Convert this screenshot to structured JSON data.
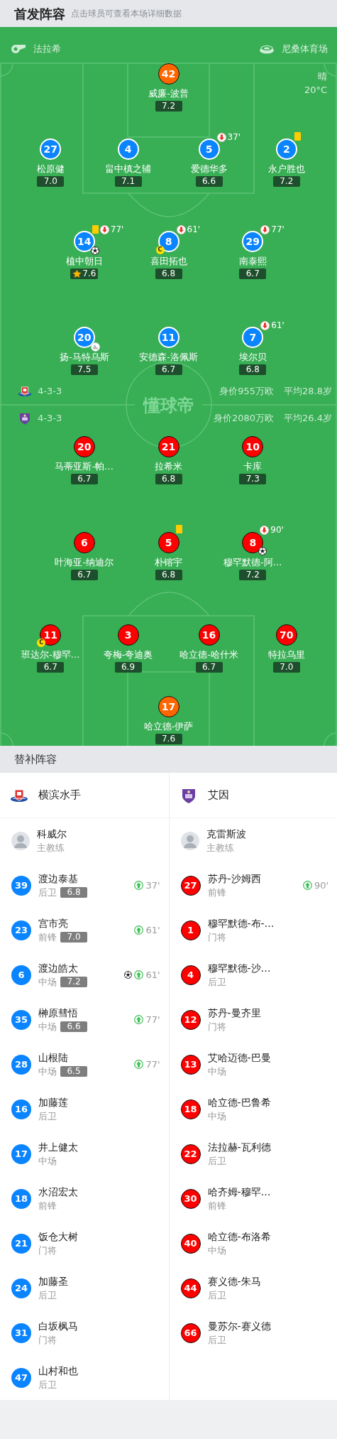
{
  "header": {
    "title": "首发阵容",
    "subtitle": "点击球员可查看本场详细数据"
  },
  "pitch": {
    "referee": "法拉希",
    "stadium": "尼桑体育场",
    "weather": "晴",
    "temperature": "20°C",
    "logo": "懂球帝",
    "teams": [
      {
        "formation": "4-3-3",
        "value": "身价955万欧",
        "avg_age": "平均28.8岁",
        "color": "#0a84ff",
        "lines": [
          {
            "kind": "goalkeeper",
            "players": [
              {
                "number": "42",
                "name": "威廉-波普",
                "rating": "7.2"
              }
            ]
          },
          {
            "kind": "outfield",
            "players": [
              {
                "number": "27",
                "name": "松原健",
                "rating": "7.0"
              },
              {
                "number": "4",
                "name": "畠中槙之辅",
                "rating": "7.1"
              },
              {
                "number": "5",
                "name": "爱德华多",
                "rating": "6.6",
                "events": [
                  {
                    "kind": "sub_out",
                    "minute": "37'"
                  }
                ]
              },
              {
                "number": "2",
                "name": "永户胜也",
                "rating": "7.2",
                "events": [
                  {
                    "kind": "yellow_card"
                  }
                ]
              }
            ]
          },
          {
            "kind": "outfield",
            "players": [
              {
                "number": "14",
                "name": "植中朝日",
                "rating": "7.6",
                "events": [
                  {
                    "kind": "mvp"
                  },
                  {
                    "kind": "yellow_card"
                  },
                  {
                    "kind": "sub_out",
                    "minute": "77'"
                  },
                  {
                    "kind": "goal"
                  }
                ]
              },
              {
                "number": "8",
                "name": "喜田拓也",
                "rating": "6.8",
                "events": [
                  {
                    "kind": "sub_out",
                    "minute": "61'"
                  },
                  {
                    "kind": "captain",
                    "label": "C"
                  }
                ]
              },
              {
                "number": "29",
                "name": "南泰熙",
                "rating": "6.7",
                "events": [
                  {
                    "kind": "sub_out",
                    "minute": "77'"
                  }
                ]
              }
            ]
          },
          {
            "kind": "outfield",
            "players": [
              {
                "number": "20",
                "name": "扬-马特乌斯",
                "rating": "7.5",
                "events": [
                  {
                    "kind": "assist"
                  }
                ]
              },
              {
                "number": "11",
                "name": "安德森-洛佩斯",
                "rating": "6.7"
              },
              {
                "number": "7",
                "name": "埃尔贝",
                "rating": "6.8",
                "events": [
                  {
                    "kind": "sub_out",
                    "minute": "61'"
                  }
                ]
              }
            ]
          }
        ]
      },
      {
        "formation": "4-3-3",
        "value": "身价2080万欧",
        "avg_age": "平均26.4岁",
        "color": "#ff0000",
        "lines": [
          {
            "kind": "outfield",
            "players": [
              {
                "number": "20",
                "name": "马蒂亚斯-帕…",
                "rating": "6.7"
              },
              {
                "number": "21",
                "name": "拉希米",
                "rating": "6.8"
              },
              {
                "number": "10",
                "name": "卡库",
                "rating": "7.3"
              }
            ]
          },
          {
            "kind": "outfield",
            "players": [
              {
                "number": "6",
                "name": "叶海亚-纳迪尔",
                "rating": "6.7"
              },
              {
                "number": "5",
                "name": "朴镕宇",
                "rating": "6.8",
                "events": [
                  {
                    "kind": "yellow_card"
                  }
                ]
              },
              {
                "number": "8",
                "name": "穆罕默德-阿…",
                "rating": "7.2",
                "events": [
                  {
                    "kind": "sub_out",
                    "minute": "90'"
                  },
                  {
                    "kind": "goal"
                  }
                ]
              }
            ]
          },
          {
            "kind": "outfield",
            "players": [
              {
                "number": "11",
                "name": "班达尔-穆罕…",
                "rating": "6.7",
                "events": [
                  {
                    "kind": "captain",
                    "label": "C"
                  }
                ]
              },
              {
                "number": "3",
                "name": "夸梅-夸迪奥",
                "rating": "6.9"
              },
              {
                "number": "16",
                "name": "哈立德-哈什米",
                "rating": "6.7"
              },
              {
                "number": "70",
                "name": "特拉乌里",
                "rating": "7.0"
              }
            ]
          },
          {
            "kind": "goalkeeper",
            "players": [
              {
                "number": "17",
                "name": "哈立德-伊萨",
                "rating": "7.6"
              }
            ]
          }
        ]
      }
    ]
  },
  "substitutes": {
    "title": "替补阵容",
    "teams": [
      {
        "name": "横滨水手",
        "coach": {
          "name": "科威尔",
          "role": "主教练"
        },
        "players": [
          {
            "number": "39",
            "name": "渡边泰基",
            "position": "后卫",
            "rating": "6.8",
            "events": [
              {
                "kind": "sub_in",
                "minute": "37'"
              }
            ]
          },
          {
            "number": "23",
            "name": "宫市亮",
            "position": "前锋",
            "rating": "7.0",
            "events": [
              {
                "kind": "sub_in",
                "minute": "61'"
              }
            ]
          },
          {
            "number": "6",
            "name": "渡边皓太",
            "position": "中场",
            "rating": "7.2",
            "events": [
              {
                "kind": "goal"
              },
              {
                "kind": "sub_in",
                "minute": "61'"
              }
            ]
          },
          {
            "number": "35",
            "name": "榊原彗悟",
            "position": "中场",
            "rating": "6.6",
            "events": [
              {
                "kind": "sub_in",
                "minute": "77'"
              }
            ]
          },
          {
            "number": "28",
            "name": "山根陆",
            "position": "中场",
            "rating": "6.5",
            "events": [
              {
                "kind": "sub_in",
                "minute": "77'"
              }
            ]
          },
          {
            "number": "16",
            "name": "加藤莲",
            "position": "后卫"
          },
          {
            "number": "17",
            "name": "井上健太",
            "position": "中场"
          },
          {
            "number": "18",
            "name": "水沼宏太",
            "position": "前锋"
          },
          {
            "number": "21",
            "name": "饭仓大树",
            "position": "门将"
          },
          {
            "number": "24",
            "name": "加藤圣",
            "position": "后卫"
          },
          {
            "number": "31",
            "name": "白坂枫马",
            "position": "门将"
          },
          {
            "number": "47",
            "name": "山村和也",
            "position": "后卫"
          }
        ]
      },
      {
        "name": "艾因",
        "coach": {
          "name": "克雷斯波",
          "role": "主教练"
        },
        "players": [
          {
            "number": "27",
            "name": "苏丹-沙姆西",
            "position": "前锋",
            "events": [
              {
                "kind": "sub_in",
                "minute": "90'"
              }
            ]
          },
          {
            "number": "1",
            "name": "穆罕默德-布-…",
            "position": "门将"
          },
          {
            "number": "4",
            "name": "穆罕默德-沙…",
            "position": "后卫"
          },
          {
            "number": "12",
            "name": "苏丹-曼齐里",
            "position": "门将"
          },
          {
            "number": "13",
            "name": "艾哈迈德-巴曼",
            "position": "中场"
          },
          {
            "number": "18",
            "name": "哈立德-巴鲁希",
            "position": "中场"
          },
          {
            "number": "22",
            "name": "法拉赫-瓦利德",
            "position": "后卫"
          },
          {
            "number": "30",
            "name": "哈齐姆-穆罕…",
            "position": "前锋"
          },
          {
            "number": "40",
            "name": "哈立德-布洛希",
            "position": "中场"
          },
          {
            "number": "44",
            "name": "赛义德-朱马",
            "position": "后卫"
          },
          {
            "number": "66",
            "name": "曼苏尔-赛义德",
            "position": "后卫"
          }
        ]
      }
    ]
  }
}
